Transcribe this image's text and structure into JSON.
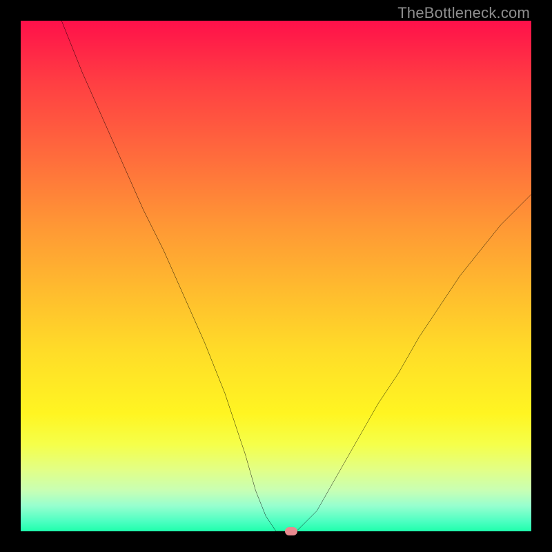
{
  "watermark": "TheBottleneck.com",
  "chart_data": {
    "type": "line",
    "title": "",
    "xlabel": "",
    "ylabel": "",
    "xlim": [
      0,
      100
    ],
    "ylim": [
      0,
      100
    ],
    "grid": false,
    "legend": false,
    "background_gradient": {
      "top_color": "#ff104a",
      "bottom_color": "#1fffac",
      "stops": [
        {
          "pct": 0,
          "color": "#ff104a"
        },
        {
          "pct": 12,
          "color": "#ff3e43"
        },
        {
          "pct": 27,
          "color": "#ff6d3c"
        },
        {
          "pct": 40,
          "color": "#ff9735"
        },
        {
          "pct": 53,
          "color": "#ffbc2e"
        },
        {
          "pct": 65,
          "color": "#ffdd28"
        },
        {
          "pct": 77,
          "color": "#fff522"
        },
        {
          "pct": 83,
          "color": "#f5ff4a"
        },
        {
          "pct": 88,
          "color": "#e2ff87"
        },
        {
          "pct": 92,
          "color": "#c8ffb4"
        },
        {
          "pct": 95,
          "color": "#97ffcf"
        },
        {
          "pct": 98,
          "color": "#4effc2"
        },
        {
          "pct": 100,
          "color": "#1fffac"
        }
      ]
    },
    "series": [
      {
        "name": "bottleneck-curve",
        "color": "#000000",
        "x": [
          8,
          12,
          16,
          20,
          24,
          28,
          32,
          36,
          40,
          44,
          46,
          48,
          50,
          52,
          54,
          58,
          62,
          66,
          70,
          74,
          78,
          82,
          86,
          90,
          94,
          98,
          100
        ],
        "y": [
          100,
          90,
          81,
          72,
          63,
          55,
          46,
          37,
          27,
          15,
          8,
          3,
          0,
          0,
          0,
          4,
          11,
          18,
          25,
          31,
          38,
          44,
          50,
          55,
          60,
          64,
          66
        ]
      }
    ],
    "marker": {
      "name": "optimal-point",
      "x": 53,
      "y": 0,
      "color": "#e88a8f"
    }
  }
}
